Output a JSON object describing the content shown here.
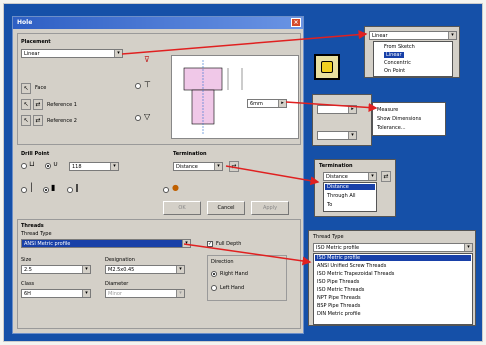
{
  "dialog": {
    "title": "Hole",
    "close_glyph": "×",
    "placement_label": "Placement",
    "placement_value": "Linear",
    "face_label": "Face",
    "reference1_label": "Reference 1",
    "reference2_label": "Reference 2",
    "dimension_value": "6mm",
    "drill_point_label": "Drill Point",
    "drill_point_value": "118",
    "termination_label": "Termination",
    "termination_value": "Distance",
    "ok_label": "OK",
    "cancel_label": "Cancel",
    "apply_label": "Apply",
    "threads_label": "Threads",
    "thread_type_label": "Thread Type",
    "thread_type_value": "ANSI Metric profile",
    "full_depth_label": "Full Depth",
    "size_label": "Size",
    "size_value": "2.5",
    "designation_label": "Designation",
    "designation_value": "M2.5x0.45",
    "class_label": "Class",
    "class_value": "6H",
    "diameter_label": "Diameter",
    "diameter_value": "Minor",
    "direction_label": "Direction",
    "right_hand_label": "Right Hand",
    "left_hand_label": "Left Hand"
  },
  "placement_popup": {
    "selected": "Linear",
    "items": [
      "From Sketch",
      "Linear",
      "Concentric",
      "On Point"
    ]
  },
  "dimension_popup": {
    "items": [
      "Measure",
      "Show Dimensions",
      "Tolerance..."
    ]
  },
  "termination_popup": {
    "label": "Termination",
    "value": "Distance",
    "items": [
      "Distance",
      "Through All",
      "To"
    ]
  },
  "thread_popup": {
    "label": "Thread Type",
    "value": "ISO Metric profile",
    "items": [
      "ISO Metric profile",
      "ANSI Unified Screw Threads",
      "ISO Metric Trapezoidal Threads",
      "ISO Pipe Threads",
      "ISO Metric Threads",
      "NPT Pipe Threads",
      "BSP Pipe Threads",
      "DIN Metric profile"
    ]
  },
  "colors": {
    "background": "#1550a8",
    "titlebar": "#2e5fc4",
    "arrow": "#e02020",
    "selection": "#1840a8"
  }
}
